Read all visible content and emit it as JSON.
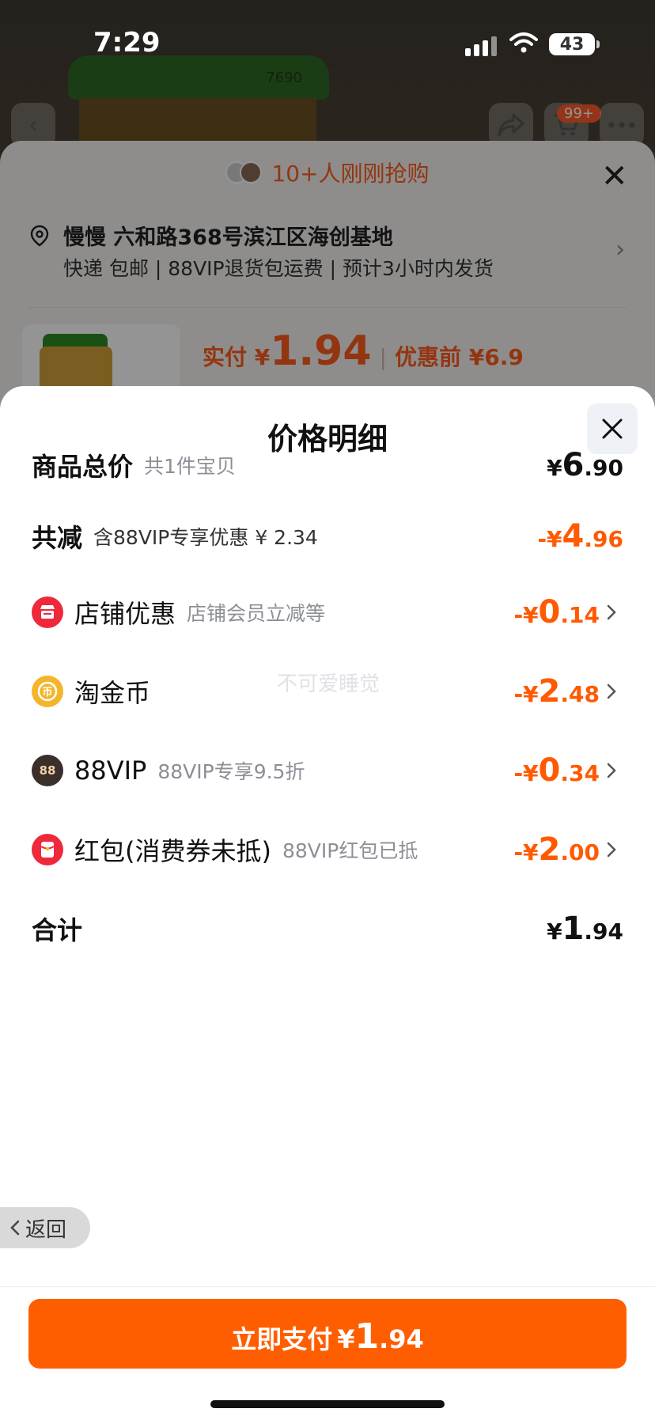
{
  "status_bar": {
    "time": "7:29",
    "battery": "43"
  },
  "background_page": {
    "jar_lid_text": "7690",
    "cart_badge": "99+",
    "recent_buyers": "10+人刚刚抢购",
    "address": {
      "name": "慢慢 六和路368号滨江区海创基地",
      "meta": "快递 包邮 | 88VIP退货包运费 | 预计3小时内发货"
    },
    "pay_label": "实付 ¥",
    "pay_amount": "1.94",
    "before_discount": "优惠前 ¥6.9"
  },
  "sheet": {
    "title": "价格明细",
    "watermark": "不可爱睡觉",
    "rows": [
      {
        "label": "商品总价",
        "sub": "共1件宝贝",
        "cur": "¥",
        "int": "6",
        "dec": ".90"
      },
      {
        "label": "共减",
        "sub": "含88VIP专享优惠 ¥ 2.34",
        "cur": "-¥",
        "int": "4",
        "dec": ".96"
      },
      {
        "label": "店铺优惠",
        "sub": "店铺会员立减等",
        "cur": "-¥",
        "int": "0",
        "dec": ".14",
        "icon": "shop-icon"
      },
      {
        "label": "淘金币",
        "sub": "",
        "cur": "-¥",
        "int": "2",
        "dec": ".48",
        "icon": "coin-icon"
      },
      {
        "label": "88VIP",
        "sub": "88VIP专享9.5折",
        "cur": "-¥",
        "int": "0",
        "dec": ".34",
        "icon": "vip-icon"
      },
      {
        "label": "红包(消费券未抵)",
        "sub": "88VIP红包已抵",
        "cur": "-¥",
        "int": "2",
        "dec": ".00",
        "icon": "red-packet-icon"
      },
      {
        "label": "合计",
        "sub": "",
        "cur": "¥",
        "int": "1",
        "dec": ".94"
      }
    ],
    "back_label": "返回",
    "pay_button": {
      "text": "立即支付",
      "cur": "¥",
      "int": "1",
      "dec": ".94"
    }
  },
  "colors": {
    "accent": "#ff5e00",
    "icon_red": "#f0283c",
    "icon_gold": "#f5b52a",
    "icon_dark": "#3a2f2a"
  }
}
